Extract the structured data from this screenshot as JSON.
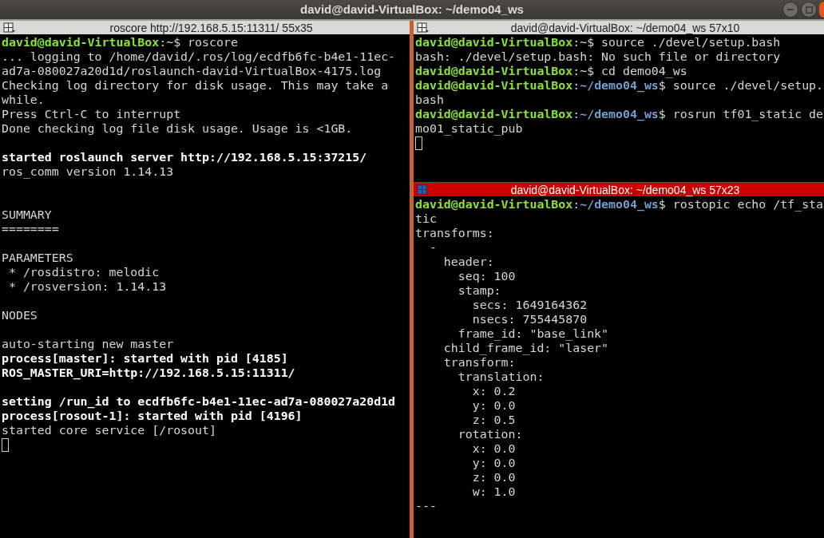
{
  "window": {
    "title": "david@david-VirtualBox: ~/demo04_ws"
  },
  "panes": [
    {
      "title": "roscore http://192.168.5.15:11311/ 55x35",
      "focused": false,
      "cursor": true,
      "lines": [
        {
          "kind": "text",
          "segments": [
            {
              "kind": "user",
              "text": "david@david-VirtualBox"
            },
            {
              "kind": "plain",
              "text": ":~$ roscore"
            }
          ]
        },
        {
          "kind": "text",
          "segments": [
            {
              "kind": "plain",
              "text": "... logging to /home/david/.ros/log/ecdfb6fc-b4e1-11ec-"
            }
          ]
        },
        {
          "kind": "text",
          "segments": [
            {
              "kind": "plain",
              "text": "ad7a-080027a20d1d/roslaunch-david-VirtualBox-4175.log"
            }
          ]
        },
        {
          "kind": "text",
          "segments": [
            {
              "kind": "plain",
              "text": "Checking log directory for disk usage. This may take a"
            }
          ]
        },
        {
          "kind": "text",
          "segments": [
            {
              "kind": "plain",
              "text": "while."
            }
          ]
        },
        {
          "kind": "text",
          "segments": [
            {
              "kind": "plain",
              "text": "Press Ctrl-C to interrupt"
            }
          ]
        },
        {
          "kind": "text",
          "segments": [
            {
              "kind": "plain",
              "text": "Done checking log file disk usage. Usage is <1GB."
            }
          ]
        },
        {
          "kind": "blank"
        },
        {
          "kind": "text",
          "segments": [
            {
              "kind": "bold",
              "text": "started roslaunch server http://192.168.5.15:37215/"
            }
          ]
        },
        {
          "kind": "text",
          "segments": [
            {
              "kind": "plain",
              "text": "ros_comm version 1.14.13"
            }
          ]
        },
        {
          "kind": "blank"
        },
        {
          "kind": "blank"
        },
        {
          "kind": "text",
          "segments": [
            {
              "kind": "plain",
              "text": "SUMMARY"
            }
          ]
        },
        {
          "kind": "text",
          "segments": [
            {
              "kind": "plain",
              "text": "========"
            }
          ]
        },
        {
          "kind": "blank"
        },
        {
          "kind": "text",
          "segments": [
            {
              "kind": "plain",
              "text": "PARAMETERS"
            }
          ]
        },
        {
          "kind": "text",
          "segments": [
            {
              "kind": "plain",
              "text": " * /rosdistro: melodic"
            }
          ]
        },
        {
          "kind": "text",
          "segments": [
            {
              "kind": "plain",
              "text": " * /rosversion: 1.14.13"
            }
          ]
        },
        {
          "kind": "blank"
        },
        {
          "kind": "text",
          "segments": [
            {
              "kind": "plain",
              "text": "NODES"
            }
          ]
        },
        {
          "kind": "blank"
        },
        {
          "kind": "text",
          "segments": [
            {
              "kind": "plain",
              "text": "auto-starting new master"
            }
          ]
        },
        {
          "kind": "text",
          "segments": [
            {
              "kind": "bold",
              "text": "process[master]: started with pid [4185]"
            }
          ]
        },
        {
          "kind": "text",
          "segments": [
            {
              "kind": "bold",
              "text": "ROS_MASTER_URI=http://192.168.5.15:11311/"
            }
          ]
        },
        {
          "kind": "blank"
        },
        {
          "kind": "text",
          "segments": [
            {
              "kind": "bold",
              "text": "setting /run_id to ecdfb6fc-b4e1-11ec-ad7a-080027a20d1d"
            }
          ]
        },
        {
          "kind": "text",
          "segments": [
            {
              "kind": "bold",
              "text": "process[rosout-1]: started with pid [4196]"
            }
          ]
        },
        {
          "kind": "text",
          "segments": [
            {
              "kind": "plain",
              "text": "started core service [/rosout]"
            }
          ]
        }
      ]
    },
    {
      "title": "david@david-VirtualBox: ~/demo04_ws 57x10",
      "focused": false,
      "cursor": true,
      "lines": [
        {
          "kind": "text",
          "segments": [
            {
              "kind": "user",
              "text": "david@david-VirtualBox"
            },
            {
              "kind": "plain",
              "text": ":~$ source ./devel/setup.bash"
            }
          ]
        },
        {
          "kind": "text",
          "segments": [
            {
              "kind": "plain",
              "text": "bash: ./devel/setup.bash: No such file or directory"
            }
          ]
        },
        {
          "kind": "text",
          "segments": [
            {
              "kind": "user",
              "text": "david@david-VirtualBox"
            },
            {
              "kind": "plain",
              "text": ":~$ cd demo04_ws"
            }
          ]
        },
        {
          "kind": "text",
          "segments": [
            {
              "kind": "user",
              "text": "david@david-VirtualBox"
            },
            {
              "kind": "plain",
              "text": ":"
            },
            {
              "kind": "path",
              "text": "~/demo04_ws"
            },
            {
              "kind": "plain",
              "text": "$ source ./devel/setup."
            }
          ]
        },
        {
          "kind": "text",
          "segments": [
            {
              "kind": "plain",
              "text": "bash"
            }
          ]
        },
        {
          "kind": "text",
          "segments": [
            {
              "kind": "user",
              "text": "david@david-VirtualBox"
            },
            {
              "kind": "plain",
              "text": ":"
            },
            {
              "kind": "path",
              "text": "~/demo04_ws"
            },
            {
              "kind": "plain",
              "text": "$ rosrun tf01_static de"
            }
          ]
        },
        {
          "kind": "text",
          "segments": [
            {
              "kind": "plain",
              "text": "mo01_static_pub"
            }
          ]
        }
      ]
    },
    {
      "title": "david@david-VirtualBox: ~/demo04_ws 57x23",
      "focused": true,
      "lines": [
        {
          "kind": "text",
          "segments": [
            {
              "kind": "user",
              "text": "david@david-VirtualBox"
            },
            {
              "kind": "plain",
              "text": ":"
            },
            {
              "kind": "path",
              "text": "~/demo04_ws"
            },
            {
              "kind": "plain",
              "text": "$ rostopic echo /tf_sta"
            }
          ]
        },
        {
          "kind": "text",
          "segments": [
            {
              "kind": "plain",
              "text": "tic"
            }
          ]
        },
        {
          "kind": "text",
          "segments": [
            {
              "kind": "plain",
              "text": "transforms:"
            }
          ]
        },
        {
          "kind": "text",
          "segments": [
            {
              "kind": "plain",
              "text": "  -"
            }
          ]
        },
        {
          "kind": "text",
          "segments": [
            {
              "kind": "plain",
              "text": "    header:"
            }
          ]
        },
        {
          "kind": "text",
          "segments": [
            {
              "kind": "plain",
              "text": "      seq: 100"
            }
          ]
        },
        {
          "kind": "text",
          "segments": [
            {
              "kind": "plain",
              "text": "      stamp:"
            }
          ]
        },
        {
          "kind": "text",
          "segments": [
            {
              "kind": "plain",
              "text": "        secs: 1649164362"
            }
          ]
        },
        {
          "kind": "text",
          "segments": [
            {
              "kind": "plain",
              "text": "        nsecs: 755445870"
            }
          ]
        },
        {
          "kind": "text",
          "segments": [
            {
              "kind": "plain",
              "text": "      frame_id: \"base_link\""
            }
          ]
        },
        {
          "kind": "text",
          "segments": [
            {
              "kind": "plain",
              "text": "    child_frame_id: \"laser\""
            }
          ]
        },
        {
          "kind": "text",
          "segments": [
            {
              "kind": "plain",
              "text": "    transform:"
            }
          ]
        },
        {
          "kind": "text",
          "segments": [
            {
              "kind": "plain",
              "text": "      translation:"
            }
          ]
        },
        {
          "kind": "text",
          "segments": [
            {
              "kind": "plain",
              "text": "        x: 0.2"
            }
          ]
        },
        {
          "kind": "text",
          "segments": [
            {
              "kind": "plain",
              "text": "        y: 0.0"
            }
          ]
        },
        {
          "kind": "text",
          "segments": [
            {
              "kind": "plain",
              "text": "        z: 0.5"
            }
          ]
        },
        {
          "kind": "text",
          "segments": [
            {
              "kind": "plain",
              "text": "      rotation:"
            }
          ]
        },
        {
          "kind": "text",
          "segments": [
            {
              "kind": "plain",
              "text": "        x: 0.0"
            }
          ]
        },
        {
          "kind": "text",
          "segments": [
            {
              "kind": "plain",
              "text": "        y: 0.0"
            }
          ]
        },
        {
          "kind": "text",
          "segments": [
            {
              "kind": "plain",
              "text": "        z: 0.0"
            }
          ]
        },
        {
          "kind": "text",
          "segments": [
            {
              "kind": "plain",
              "text": "        w: 1.0"
            }
          ]
        },
        {
          "kind": "text",
          "segments": [
            {
              "kind": "plain",
              "text": "---"
            }
          ]
        }
      ]
    }
  ]
}
